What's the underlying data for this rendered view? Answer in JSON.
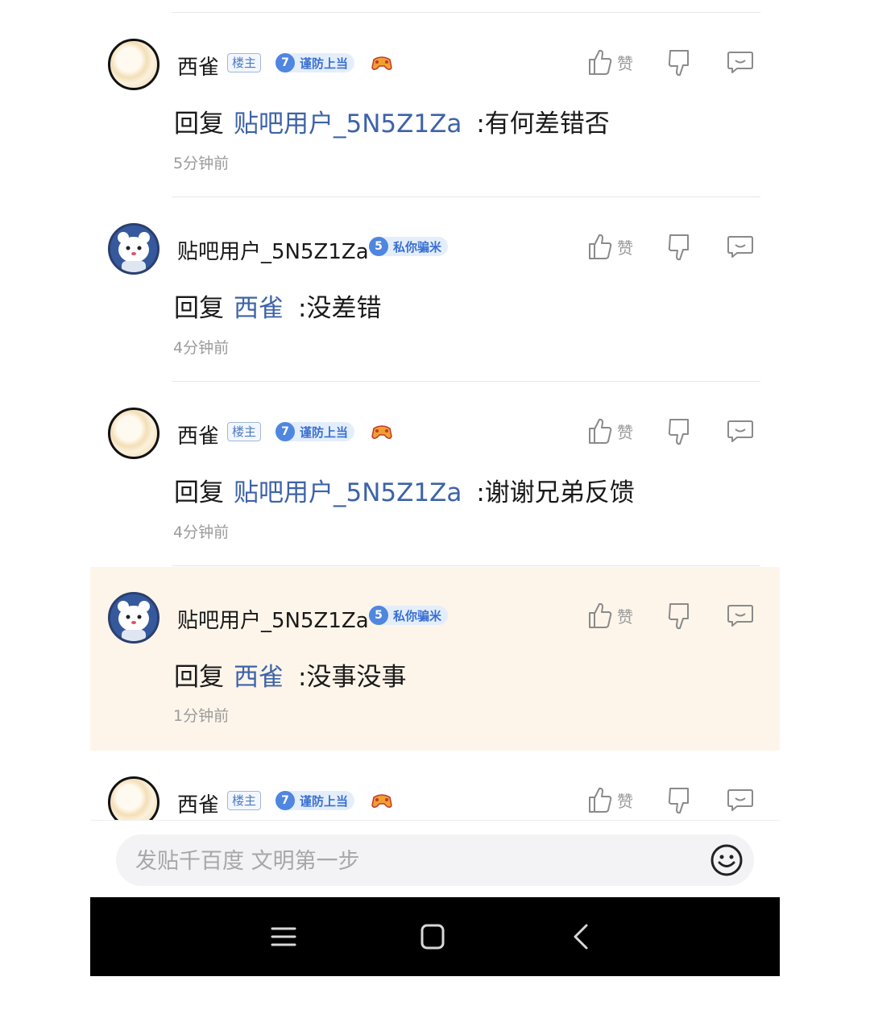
{
  "reply_prefix": "回复",
  "like_label": "赞",
  "comments": [
    {
      "author": "西雀",
      "louzhu": "楼主",
      "level": "7",
      "level_title": "谨防上当",
      "target": "贴吧用户_5N5Z1Za",
      "text": ":有何差错否",
      "time": "5分钟前"
    },
    {
      "author": "贴吧用户_5N5Z1Za",
      "level": "5",
      "level_title": "私你骗米",
      "target": "西雀",
      "text": ":没差错",
      "time": "4分钟前"
    },
    {
      "author": "西雀",
      "louzhu": "楼主",
      "level": "7",
      "level_title": "谨防上当",
      "target": "贴吧用户_5N5Z1Za",
      "text": ":谢谢兄弟反馈",
      "time": "4分钟前"
    },
    {
      "author": "贴吧用户_5N5Z1Za",
      "level": "5",
      "level_title": "私你骗米",
      "target": "西雀",
      "text": ":没事没事",
      "time": "1分钟前"
    },
    {
      "author": "西雀",
      "louzhu": "楼主",
      "level": "7",
      "level_title": "谨防上当"
    }
  ],
  "input": {
    "placeholder": "发贴千百度 文明第一步"
  },
  "colors": {
    "accent": "#3d63a8",
    "highlight_bg": "#fdf5ea",
    "level_blue": "#4f86e0"
  },
  "icons": [
    "thumbs-up-icon",
    "thumbs-down-icon",
    "reply-bubble-icon",
    "emoji-icon",
    "menu-icon",
    "home-icon",
    "back-icon"
  ]
}
